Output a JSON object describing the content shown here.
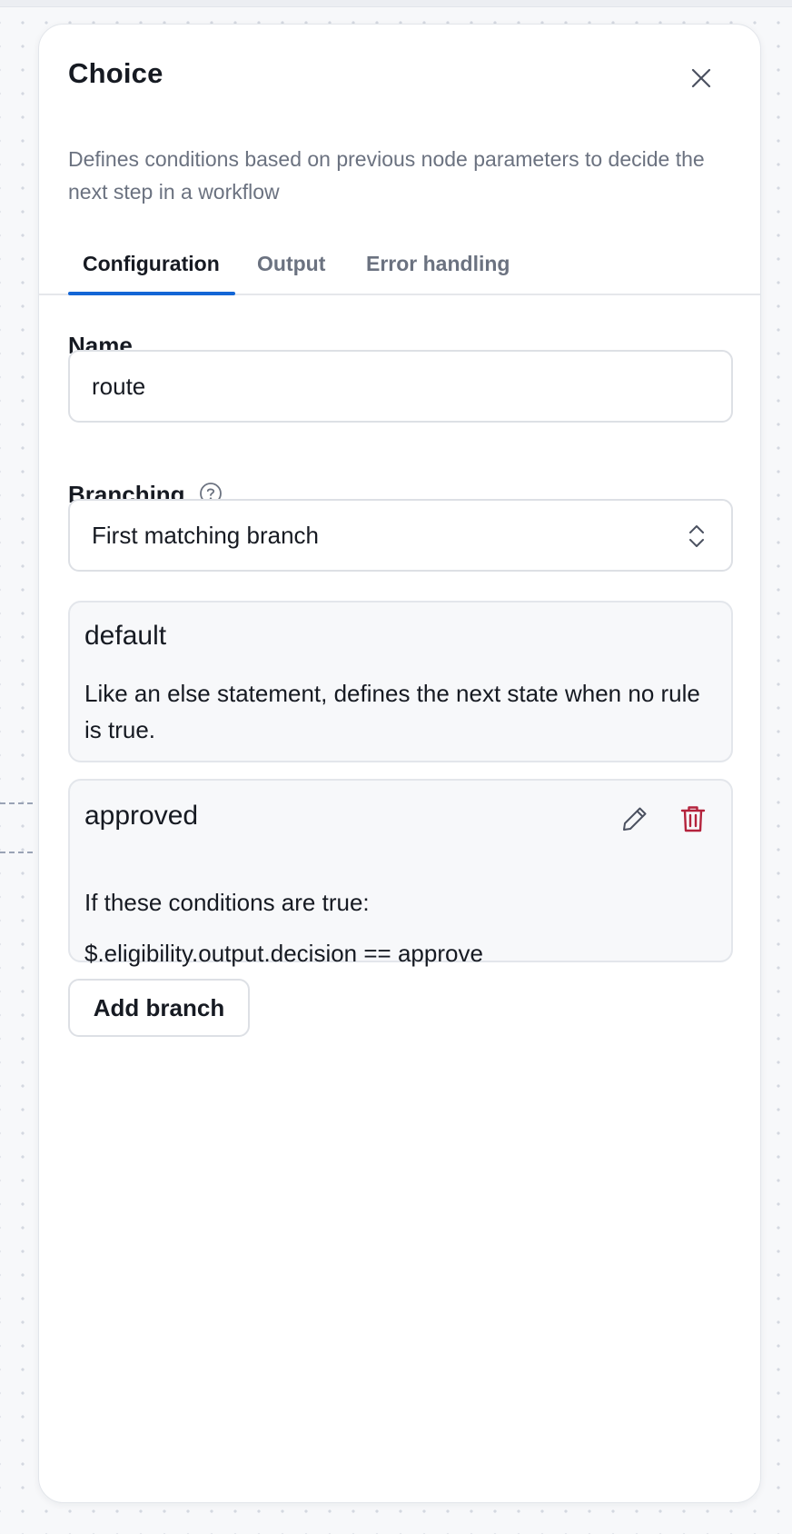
{
  "panel": {
    "title": "Choice",
    "description": "Defines conditions based on previous node parameters to decide the next step in a workflow"
  },
  "tabs": [
    {
      "label": "Configuration",
      "active": true
    },
    {
      "label": "Output",
      "active": false
    },
    {
      "label": "Error handling",
      "active": false
    }
  ],
  "form": {
    "name_label": "Name",
    "name_value": "route",
    "branching_label": "Branching",
    "branching_value": "First matching branch"
  },
  "branches": [
    {
      "name": "default",
      "text": "Like an else statement, defines the next state when no rule is true."
    },
    {
      "name": "approved",
      "conditions_label": "If these conditions are true:",
      "condition": "$.eligibility.output.decision == approve"
    }
  ],
  "add_branch_label": "Add branch",
  "icons": {
    "close": "close-icon",
    "help": "help-circle-icon",
    "select": "chevron-up-down-icon",
    "edit": "pencil-icon",
    "delete": "trash-icon"
  },
  "colors": {
    "accent": "#1366d6",
    "danger": "#b4233c",
    "text": "#161a22",
    "muted": "#6b7280"
  }
}
